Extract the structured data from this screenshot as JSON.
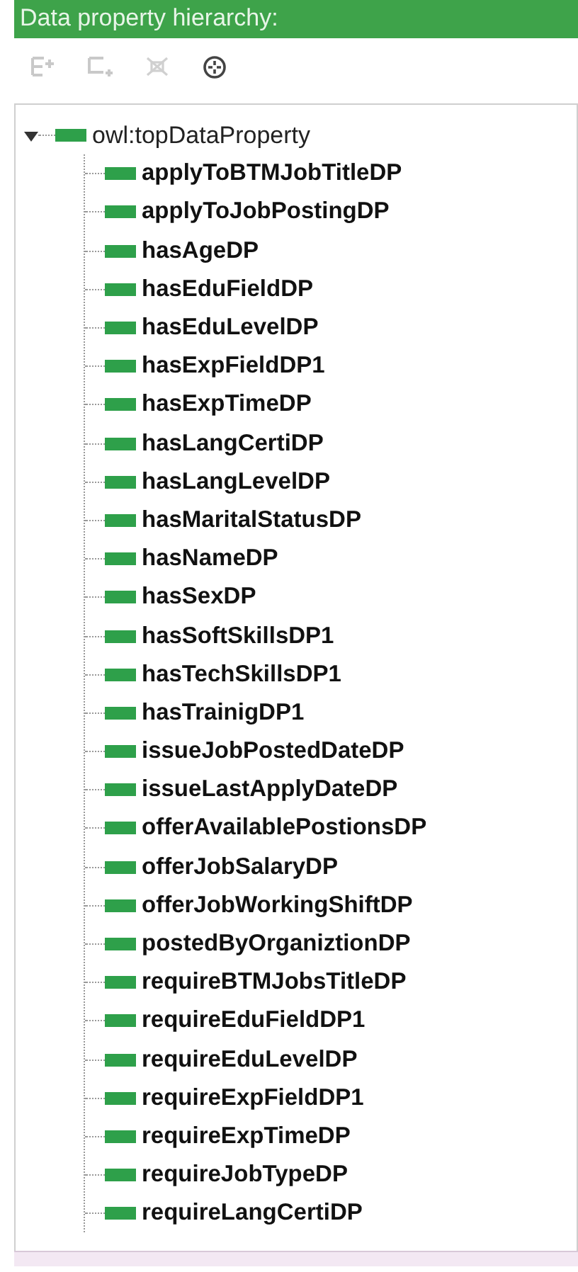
{
  "header": {
    "title": "Data property hierarchy:"
  },
  "toolbar": [
    {
      "kind": "add-sub",
      "disabled": true
    },
    {
      "kind": "add-sibling",
      "disabled": true
    },
    {
      "kind": "delete",
      "disabled": true
    },
    {
      "kind": "find",
      "disabled": false
    }
  ],
  "tree": {
    "label": "owl:topDataProperty",
    "expanded": true,
    "children": [
      {
        "label": "applyToBTMJobTitleDP"
      },
      {
        "label": "applyToJobPostingDP"
      },
      {
        "label": "hasAgeDP"
      },
      {
        "label": "hasEduFieldDP"
      },
      {
        "label": "hasEduLevelDP"
      },
      {
        "label": "hasExpFieldDP1"
      },
      {
        "label": "hasExpTimeDP"
      },
      {
        "label": "hasLangCertiDP"
      },
      {
        "label": "hasLangLevelDP"
      },
      {
        "label": "hasMaritalStatusDP"
      },
      {
        "label": "hasNameDP"
      },
      {
        "label": "hasSexDP"
      },
      {
        "label": "hasSoftSkillsDP1"
      },
      {
        "label": "hasTechSkillsDP1"
      },
      {
        "label": "hasTrainigDP1"
      },
      {
        "label": "issueJobPostedDateDP"
      },
      {
        "label": "issueLastApplyDateDP"
      },
      {
        "label": "offerAvailablePostionsDP"
      },
      {
        "label": "offerJobSalaryDP"
      },
      {
        "label": "offerJobWorkingShiftDP"
      },
      {
        "label": "postedByOrganiztionDP"
      },
      {
        "label": "requireBTMJobsTitleDP"
      },
      {
        "label": "requireEduFieldDP1"
      },
      {
        "label": "requireEduLevelDP"
      },
      {
        "label": "requireExpFieldDP1"
      },
      {
        "label": "requireExpTimeDP"
      },
      {
        "label": "requireJobTypeDP"
      },
      {
        "label": "requireLangCertiDP"
      }
    ]
  }
}
